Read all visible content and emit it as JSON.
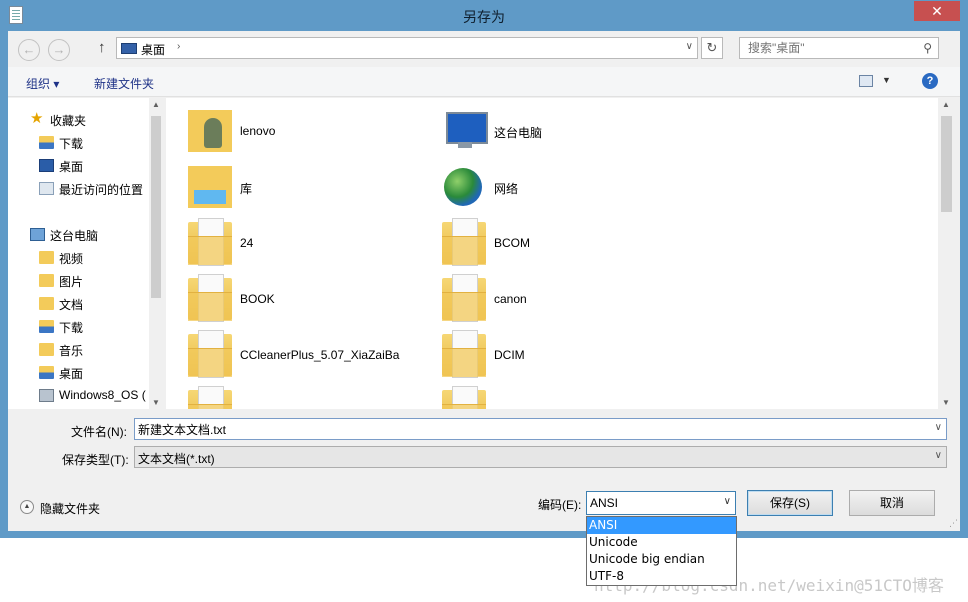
{
  "window": {
    "title": "另存为",
    "close_glyph": "✕"
  },
  "addressbar": {
    "back_glyph": "←",
    "forward_glyph": "→",
    "up_glyph": "↑",
    "location": "桌面",
    "crumb_arrow": "›",
    "dropdown_glyph": "∨",
    "refresh_glyph": "↻",
    "search_placeholder": "搜索\"桌面\"",
    "search_glyph": "⚲"
  },
  "toolbar": {
    "organize": "组织 ▾",
    "new_folder": "新建文件夹",
    "view_dropdown_glyph": "▼",
    "help_glyph": "?"
  },
  "navpane": {
    "items": [
      {
        "label": "收藏夹",
        "icon": "star-icon"
      },
      {
        "label": "下载",
        "icon": "download-folder-icon"
      },
      {
        "label": "桌面",
        "icon": "desktop-icon"
      },
      {
        "label": "最近访问的位置",
        "icon": "recent-places-icon"
      },
      {
        "label": "这台电脑",
        "icon": "computer-icon"
      },
      {
        "label": "视频",
        "icon": "videos-folder-icon"
      },
      {
        "label": "图片",
        "icon": "pictures-folder-icon"
      },
      {
        "label": "文档",
        "icon": "documents-folder-icon"
      },
      {
        "label": "下载",
        "icon": "download-folder-icon"
      },
      {
        "label": "音乐",
        "icon": "music-folder-icon"
      },
      {
        "label": "桌面",
        "icon": "desktop-folder-icon"
      },
      {
        "label": "Windows8_OS (",
        "icon": "drive-icon"
      }
    ]
  },
  "files": [
    {
      "name": "lenovo",
      "icon": "user-folder-icon"
    },
    {
      "name": "这台电脑",
      "icon": "computer-icon"
    },
    {
      "name": "库",
      "icon": "libraries-icon"
    },
    {
      "name": "网络",
      "icon": "network-icon"
    },
    {
      "name": "24",
      "icon": "folder-icon"
    },
    {
      "name": "BCOM",
      "icon": "folder-icon"
    },
    {
      "name": "BOOK",
      "icon": "folder-icon"
    },
    {
      "name": "canon",
      "icon": "folder-icon"
    },
    {
      "name": "CCleanerPlus_5.07_XiaZaiBa",
      "icon": "folder-icon"
    },
    {
      "name": "DCIM",
      "icon": "folder-icon"
    }
  ],
  "scroll": {
    "up_glyph": "▲",
    "down_glyph": "▼"
  },
  "form": {
    "filename_label": "文件名(N):",
    "filename_value": "新建文本文档.txt",
    "filetype_label": "保存类型(T):",
    "filetype_value": "文本文档(*.txt)",
    "dropdown_glyph": "∨"
  },
  "footer": {
    "hide_folders": "隐藏文件夹",
    "hide_glyph": "▲",
    "encoding_label": "编码(E):",
    "encoding_value": "ANSI",
    "encoding_options": [
      "ANSI",
      "Unicode",
      "Unicode big endian",
      "UTF-8"
    ],
    "save_button": "保存(S)",
    "cancel_button": "取消",
    "grip_glyph": "⋰"
  },
  "watermark": "http://blog.csdn.net/weixin@51CTO博客"
}
